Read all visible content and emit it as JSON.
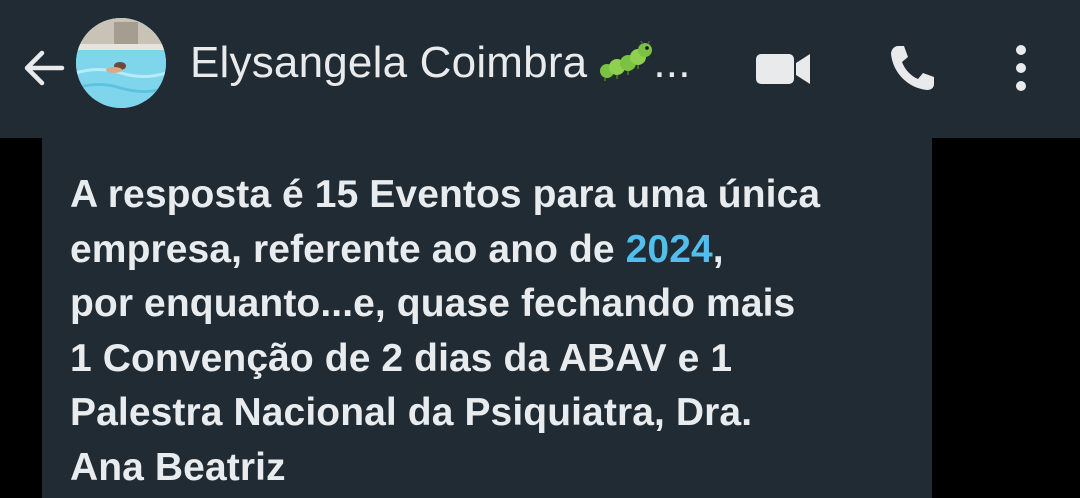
{
  "header": {
    "contact_name": "Elysangela Coimbra",
    "name_suffix": "...",
    "name_emoji_icon": "caterpillar-icon",
    "icons": {
      "back": "back-arrow-icon",
      "video": "video-camera-icon",
      "call": "phone-icon",
      "menu": "more-vertical-icon"
    }
  },
  "message": {
    "lines": [
      {
        "text": "A resposta é 15 Eventos para uma única"
      },
      {
        "before": "empresa, referente ao ano de ",
        "link": "2024",
        "after": ","
      },
      {
        "text": "por enquanto...e, quase fechando mais"
      },
      {
        "text": "1 Convenção de 2 dias da ABAV e 1"
      },
      {
        "text": "Palestra Nacional da Psiquiatra, Dra."
      },
      {
        "text": "Ana Beatriz"
      }
    ]
  },
  "colors": {
    "header_bg": "#212b33",
    "bubble_bg": "#212b33",
    "page_bg": "#000000",
    "text": "#e9ecee",
    "link": "#53bdeb"
  }
}
